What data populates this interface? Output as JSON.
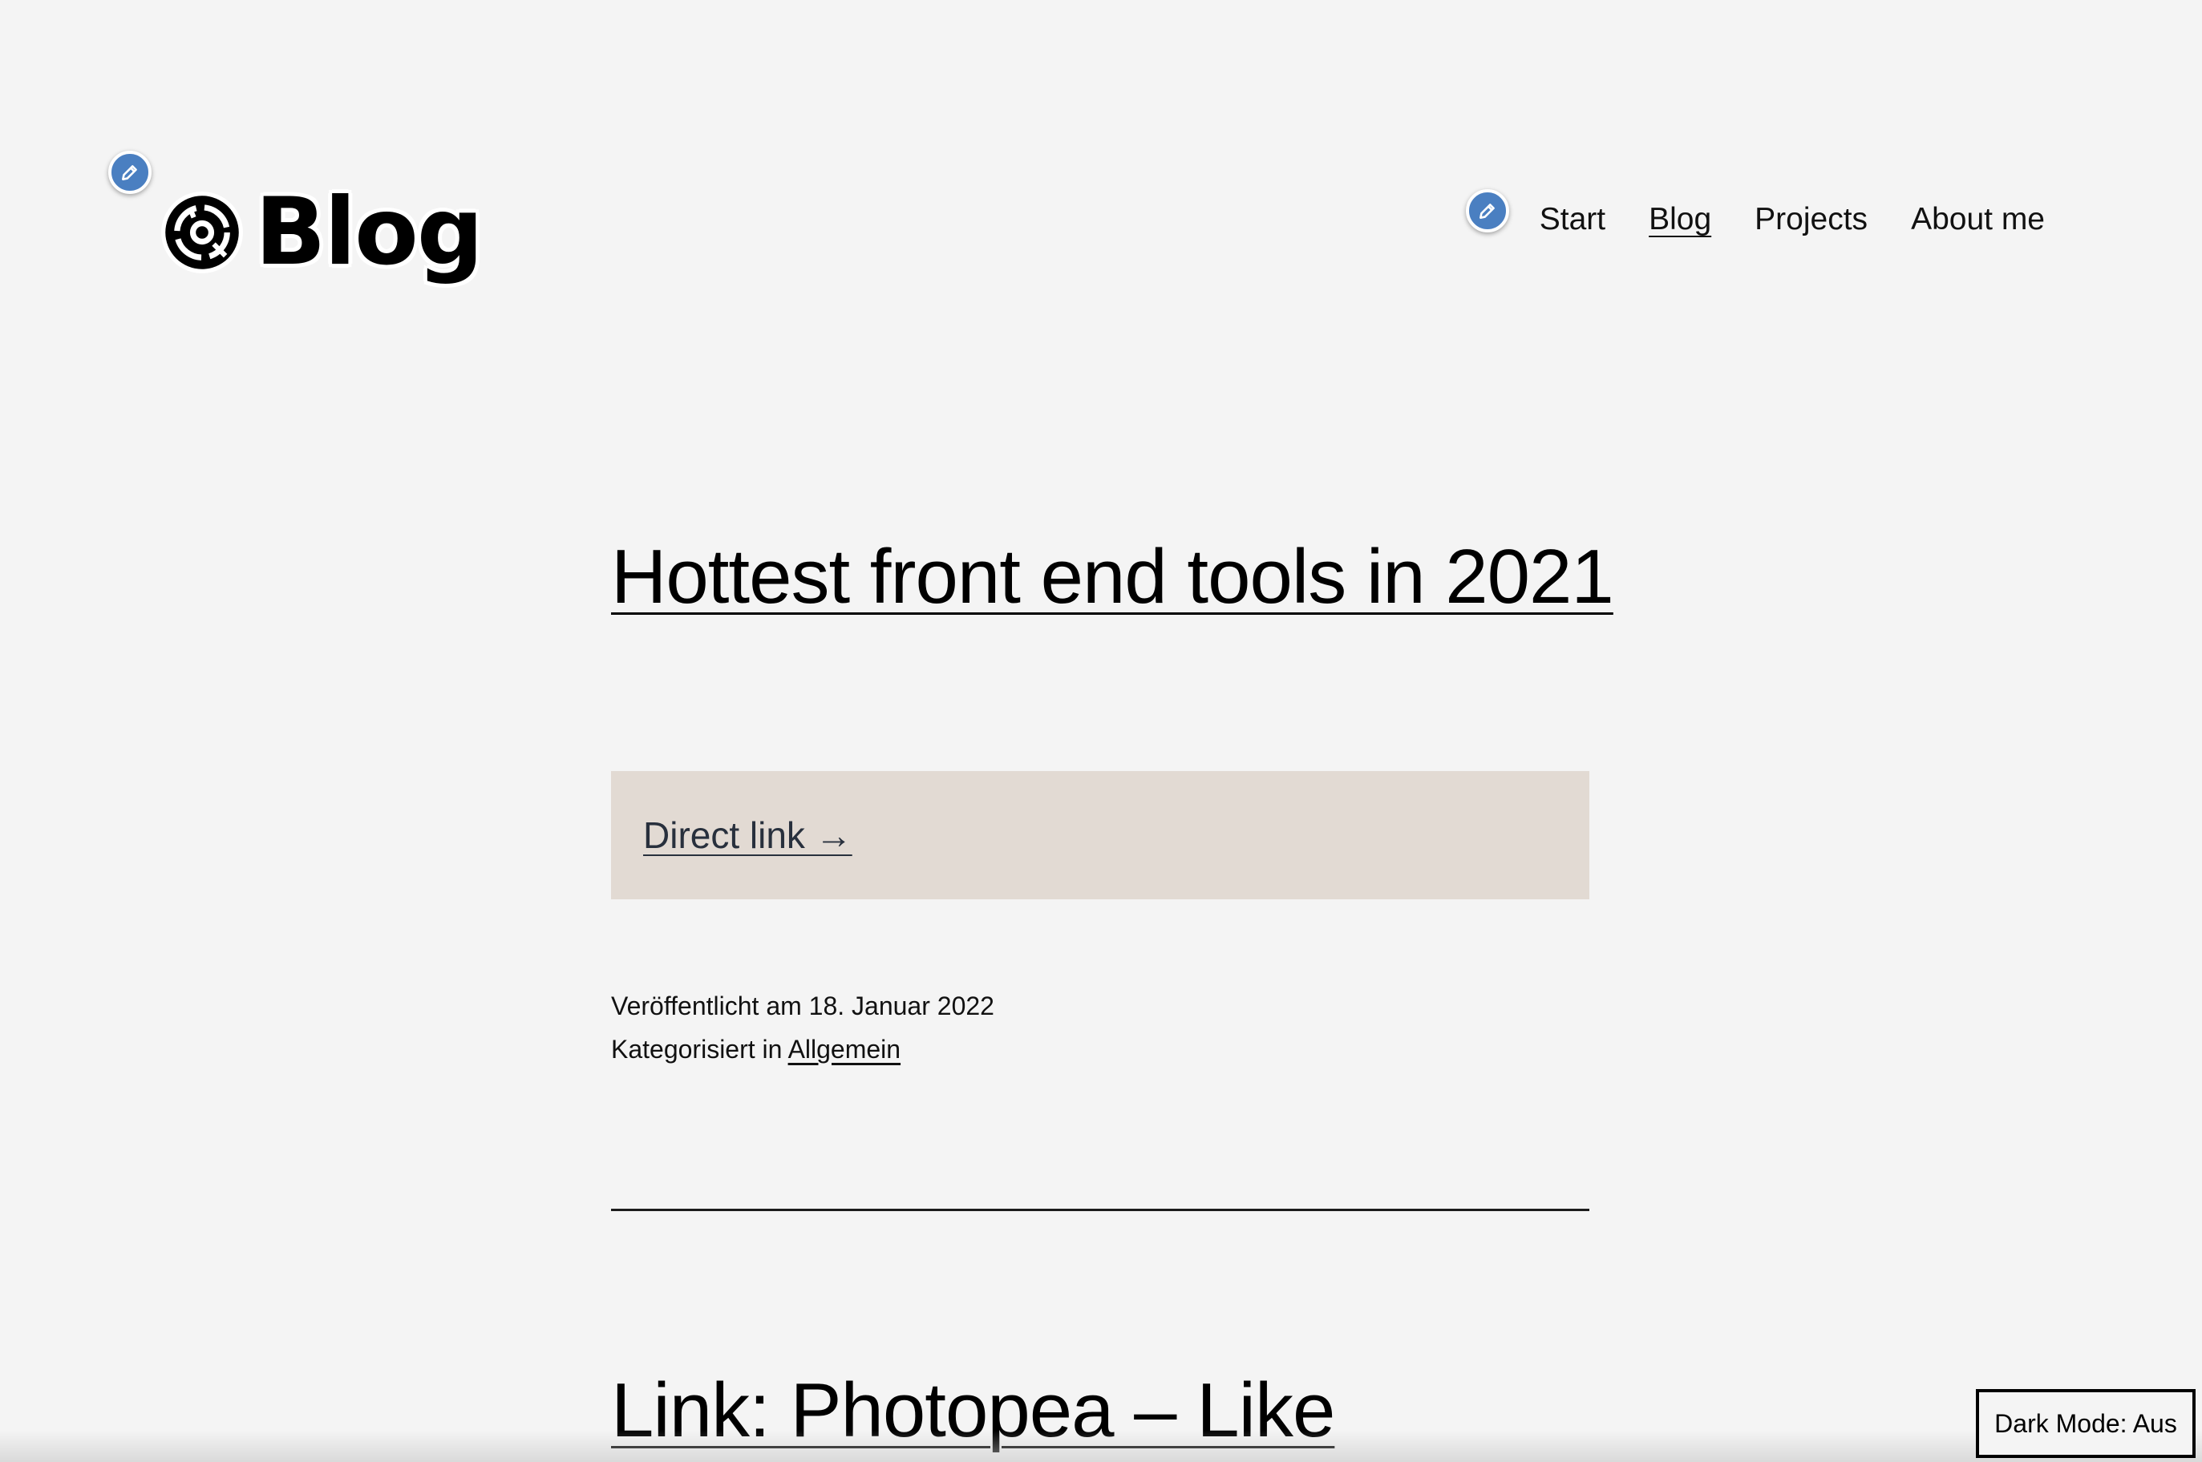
{
  "header": {
    "logo_text": "Blog",
    "logo_icon": "camera-lens-logo-icon",
    "edit_icon": "pencil-icon"
  },
  "nav": {
    "items": [
      {
        "label": "Start",
        "current": false
      },
      {
        "label": "Blog",
        "current": true
      },
      {
        "label": "Projects",
        "current": false
      },
      {
        "label": "About me",
        "current": false
      }
    ]
  },
  "posts": [
    {
      "title": "Hottest front end tools in 2021",
      "direct_link_label": "Direct link →",
      "published": "Veröffentlicht am 18. Januar 2022",
      "category_prefix": "Kategorisiert in ",
      "category": "Allgemein"
    },
    {
      "title": "Link: Photopea – Like"
    }
  ],
  "dark_mode": {
    "label": "Dark Mode: Aus"
  },
  "colors": {
    "background": "#f4f4f4",
    "link_box": "#e2dad3",
    "edit_shortcut": "#4a7fc1"
  }
}
